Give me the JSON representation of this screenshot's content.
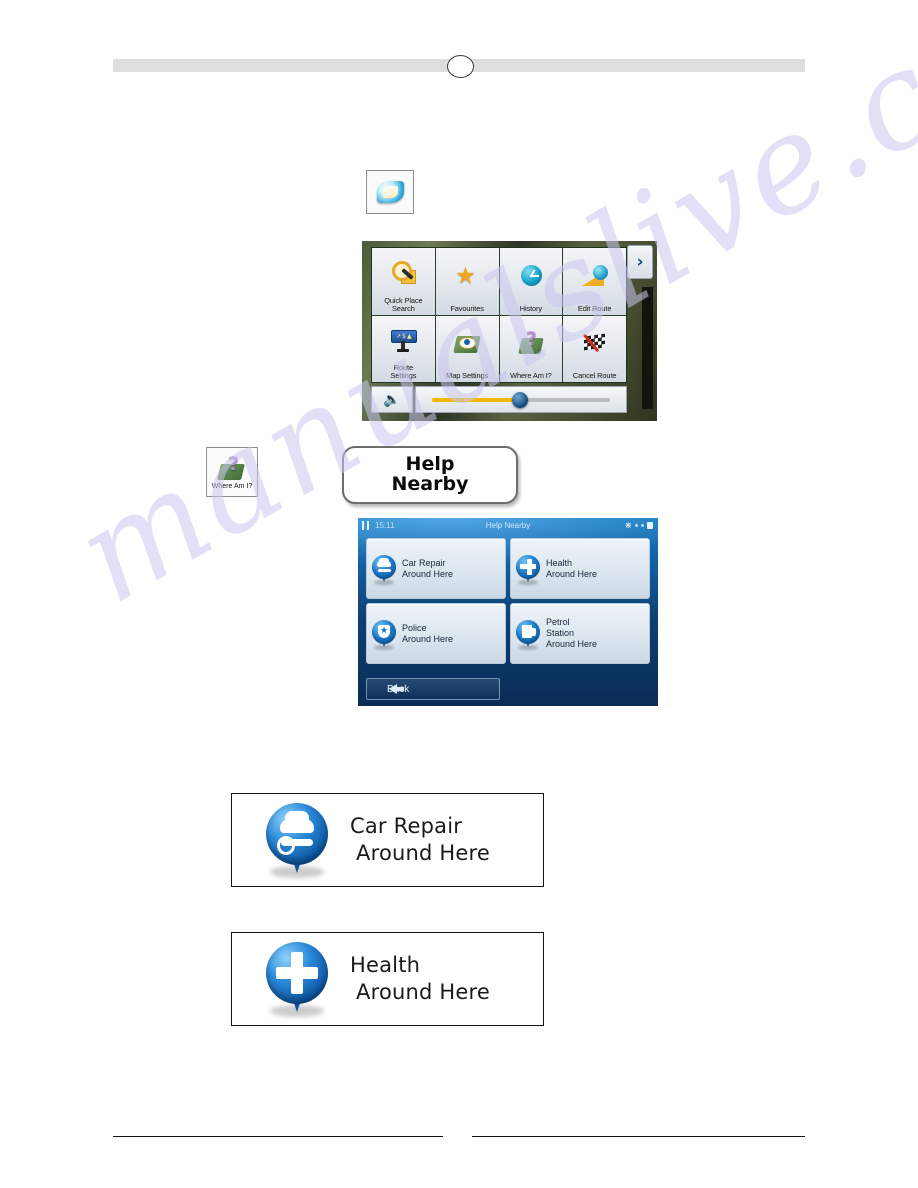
{
  "page": {
    "watermark": "manualslive.com",
    "header": {
      "bar_label": "",
      "page_marker": ""
    }
  },
  "icon_thumbnails": {
    "more_button": {
      "name": "more-icon",
      "label": ""
    },
    "where_am_i": {
      "name": "where-am-i-icon",
      "label": "Where Am I?"
    }
  },
  "pill_button": {
    "line1": "Help",
    "line2": "Nearby"
  },
  "nav_screenshot": {
    "chevron": "›",
    "cells": [
      {
        "label": "Quick Place Search",
        "line1": "Quick Place",
        "line2": "Search",
        "icon": "quick-place-search-icon"
      },
      {
        "label": "Favourites",
        "line1": "Favourites",
        "line2": "",
        "icon": "favourites-star-icon"
      },
      {
        "label": "History",
        "line1": "History",
        "line2": "",
        "icon": "history-clock-icon"
      },
      {
        "label": "Edit Route",
        "line1": "Edit Route",
        "line2": "",
        "icon": "edit-route-icon"
      },
      {
        "label": "Route Settings",
        "line1": "Route",
        "line2": "Settings",
        "icon": "route-settings-icon"
      },
      {
        "label": "Map Settings",
        "line1": "Map Settings",
        "line2": "",
        "icon": "map-settings-icon"
      },
      {
        "label": "Where Am I?",
        "line1": "Where Am I?",
        "line2": "",
        "icon": "where-am-i-icon"
      },
      {
        "label": "Cancel Route",
        "line1": "Cancel Route",
        "line2": "",
        "icon": "cancel-route-icon"
      }
    ],
    "volume": {
      "speaker_icon": "speaker-icon",
      "value_percent": 42
    }
  },
  "help_nearby_screenshot": {
    "status_bar": {
      "time": "15:11",
      "title": "Help Nearby",
      "gps_icon": "satellite-icon",
      "battery_icon": "battery-icon"
    },
    "buttons": [
      {
        "line1": "Car Repair",
        "line2": "Around Here",
        "icon": "car-repair-pin-icon"
      },
      {
        "line1": "Health",
        "line2": "Around Here",
        "icon": "health-pin-icon"
      },
      {
        "line1": "Police",
        "line2": "Around Here",
        "icon": "police-pin-icon"
      },
      {
        "line1": "Petrol",
        "line2": "Station",
        "line3": "Around Here",
        "icon": "petrol-station-pin-icon"
      }
    ],
    "back_button": "Back"
  },
  "callouts": [
    {
      "line1": "Car Repair",
      "line2": "Around Here",
      "icon": "car-repair-pin-icon"
    },
    {
      "line1": "Health",
      "line2": "Around Here",
      "icon": "health-pin-icon"
    }
  ],
  "colors": {
    "accent_blue": "#1f7fc4",
    "pin_blue": "#0f5aa5",
    "header_gray": "#dedede",
    "watermark": "#c9c7ef"
  }
}
